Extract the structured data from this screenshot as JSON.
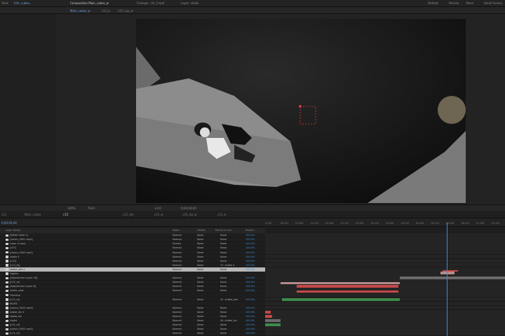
{
  "top_bar": {
    "left": [
      "Tools",
      "Info, cubes..."
    ],
    "composition_tab": "Composition Main_cubes_w",
    "footage_tab": "Footage: c11_f.mp4",
    "layer_tab": "Layer: shake",
    "right": [
      "Default",
      "Review",
      "More",
      "Small Screen"
    ]
  },
  "viewer_tabs": [
    "Main_cubes_w",
    "c11_b",
    "c15_cap_w"
  ],
  "viewer_footer": {
    "zoom": "100%",
    "res": "Third",
    "timecode": "0;00;00;00",
    "extra": "+0.0"
  },
  "timeline_tabs": [
    "c11",
    "Main_cubes",
    "c15",
    "c21_dia",
    "c21_w",
    "c25_dia_w",
    "c11_w"
  ],
  "timeline_toolbar": {
    "time": "0;00;05;06"
  },
  "ruler_ticks": [
    "0:00f",
    "00:15f",
    "01:00f",
    "01:15f",
    "02:00f",
    "02:15f",
    "03:00f",
    "03:15f",
    "04:00f",
    "04:15f",
    "05:00f",
    "05:15f",
    "06:00f",
    "06:15f",
    "07:00f",
    "07:15f"
  ],
  "columns": {
    "name": "Layer Name",
    "mode": "Mode",
    "trkmat": "TrkMat",
    "parent": "Parent & Link",
    "stretch": "Stretch"
  },
  "layers": [
    {
      "name": "[White Solid 1]",
      "mode": "Normal",
      "trk": "None",
      "parent": "None",
      "stretch": "100.0%"
    },
    {
      "name": "[colors_0001.mp4]",
      "mode": "Normal",
      "trk": "None",
      "parent": "None",
      "stretch": "100.0%"
    },
    {
      "name": "Layer 4 copy",
      "mode": "Screen",
      "trk": "None",
      "parent": "None",
      "stretch": "100.0%"
    },
    {
      "name": "[c07]",
      "mode": "Normal",
      "trk": "None",
      "parent": "None",
      "stretch": "100.0%"
    },
    {
      "name": "[colors_0003.mp4]",
      "mode": "Normal",
      "trk": "None",
      "parent": "None",
      "stretch": "100.0%"
    },
    {
      "name": "shake 4",
      "mode": "Normal",
      "trk": "None",
      "parent": "None",
      "stretch": "100.0%"
    },
    {
      "name": "[c12]",
      "mode": "Normal",
      "trk": "None",
      "parent": "None",
      "stretch": "100.0%"
    },
    {
      "name": "[c13_to]",
      "mode": "Normal",
      "trk": "None",
      "parent": "71. shake 4",
      "stretch": "100.0%"
    },
    {
      "name": "shake_one c",
      "mode": "Normal",
      "trk": "None",
      "parent": "None",
      "stretch": "100.0%",
      "selected": true
    },
    {
      "name": "Fighter",
      "mode": "",
      "trk": "",
      "parent": "",
      "stretch": ""
    },
    {
      "name": "[Adjustment Layer 16]",
      "mode": "Normal",
      "trk": "None",
      "parent": "None",
      "stretch": "100.0%"
    },
    {
      "name": "[c12_m]",
      "mode": "Normal",
      "trk": "None",
      "parent": "None",
      "stretch": "100.0%"
    },
    {
      "name": "[Adjustment Layer 8]",
      "mode": "Normal",
      "trk": "None",
      "parent": "None",
      "stretch": "100.0%"
    },
    {
      "name": "shake_slow",
      "mode": "Normal",
      "trk": "None",
      "parent": "None",
      "stretch": "100.0%"
    },
    {
      "name": "Timeline",
      "mode": "",
      "trk": "",
      "parent": "",
      "stretch": ""
    },
    {
      "name": "[c12_m]",
      "mode": "Normal",
      "trk": "None",
      "parent": "41. shake_one",
      "stretch": "100.0%"
    },
    {
      "name": "MUSIC",
      "mode": "",
      "trk": "",
      "parent": "",
      "stretch": ""
    },
    {
      "name": "[colors_0010.mp4]",
      "mode": "Normal",
      "trk": "None",
      "parent": "None",
      "stretch": "100.0%"
    },
    {
      "name": "shake_lev 2",
      "mode": "Normal",
      "trk": "None",
      "parent": "None",
      "stretch": "100.0%"
    },
    {
      "name": "shake_lev",
      "mode": "Normal",
      "trk": "None",
      "parent": "None",
      "stretch": "100.0%"
    },
    {
      "name": "shake",
      "mode": "Normal",
      "trk": "None",
      "parent": "44. shake_lev",
      "stretch": "100.0%"
    },
    {
      "name": "[c11_m]",
      "mode": "Normal",
      "trk": "None",
      "parent": "None",
      "stretch": "100.0%"
    },
    {
      "name": "[colors_0002.mp4]",
      "mode": "Normal",
      "trk": "None",
      "parent": "None",
      "stretch": "100.0%"
    },
    {
      "name": "[c11_m]",
      "mode": "Normal",
      "trk": "None",
      "parent": "None",
      "stretch": "100.0%"
    }
  ],
  "colors": {
    "accent": "#3c8ddb",
    "selected_row": "#b7b7b7",
    "bar_red": "#c44848",
    "bar_green": "#3d8a4a",
    "bar_gray": "#6a6a6a",
    "bar_pink": "#b48b8b"
  }
}
